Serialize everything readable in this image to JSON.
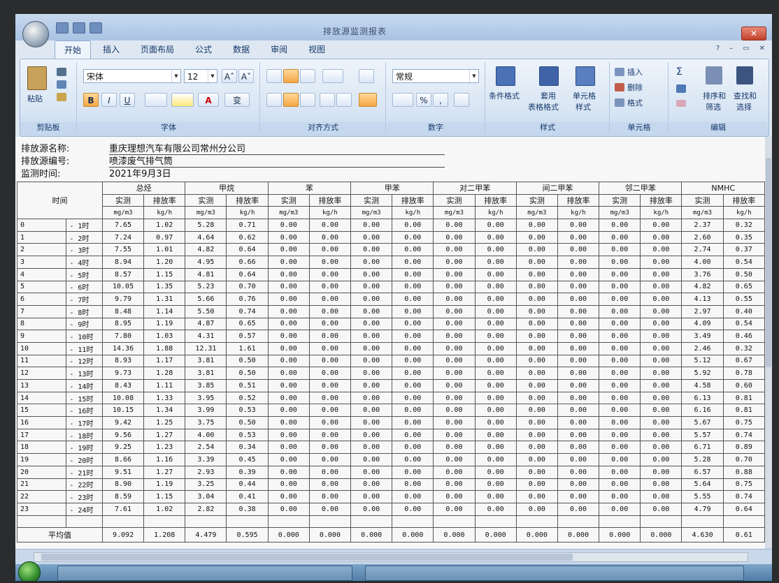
{
  "window": {
    "title": "排放源监测报表",
    "close_glyph": "✕",
    "controls": [
      "?",
      "–",
      "▭",
      "✕"
    ]
  },
  "tabs": [
    "开始",
    "插入",
    "页面布局",
    "公式",
    "数据",
    "审阅",
    "视图"
  ],
  "ribbon": {
    "clipboard": {
      "paste": "粘贴",
      "label": "剪贴板"
    },
    "font": {
      "name": "宋体",
      "size": "12",
      "grow": "A˄",
      "shrink": "A˅",
      "bold": "B",
      "italic": "I",
      "underline": "U",
      "color_glyph": "A",
      "wen": "变",
      "label": "字体"
    },
    "align": {
      "label": "对齐方式"
    },
    "number": {
      "format": "常规",
      "percent": "%",
      "comma": ",",
      "label": "数字"
    },
    "styles": {
      "cond": "条件格式",
      "table1": "套用",
      "table2": "表格格式",
      "cell1": "单元格",
      "cell2": "样式",
      "label": "样式"
    },
    "cells": {
      "insert": "插入",
      "delete": "删除",
      "format": "格式",
      "label": "单元格"
    },
    "editing": {
      "sort1": "排序和",
      "sort2": "筛选",
      "find1": "查找和",
      "find2": "选择",
      "label": "编辑"
    }
  },
  "sheet": {
    "meta": [
      {
        "label": "排放源名称:",
        "value": "重庆理想汽车有限公司常州分公司"
      },
      {
        "label": "排放源编号:",
        "value": "喷漆废气排气筒"
      },
      {
        "label": "监测时间:",
        "value": "2021年9月3日"
      }
    ],
    "time_header": "时间",
    "groups": [
      "总烃",
      "甲烷",
      "苯",
      "甲苯",
      "对二甲苯",
      "间二甲苯",
      "邻二甲苯",
      "NMHC"
    ],
    "sub_measured": "实测",
    "sub_rate": "排放率",
    "unit_measured": "mg/m3",
    "unit_rate": "kg/h",
    "zero": "0.00",
    "avg_label": "平均值",
    "rows": [
      {
        "h": "0",
        "r": "- 1时",
        "v": [
          "7.65",
          "1.02",
          "5.28",
          "0.71",
          "2.37",
          "0.32"
        ]
      },
      {
        "h": "1",
        "r": "- 2时",
        "v": [
          "7.24",
          "0.97",
          "4.64",
          "0.62",
          "2.60",
          "0.35"
        ]
      },
      {
        "h": "2",
        "r": "- 3时",
        "v": [
          "7.55",
          "1.01",
          "4.82",
          "0.64",
          "2.74",
          "0.37"
        ]
      },
      {
        "h": "3",
        "r": "- 4时",
        "v": [
          "8.94",
          "1.20",
          "4.95",
          "0.66",
          "4.00",
          "0.54"
        ]
      },
      {
        "h": "4",
        "r": "- 5时",
        "v": [
          "8.57",
          "1.15",
          "4.81",
          "0.64",
          "3.76",
          "0.50"
        ]
      },
      {
        "h": "5",
        "r": "- 6时",
        "v": [
          "10.05",
          "1.35",
          "5.23",
          "0.70",
          "4.82",
          "0.65"
        ]
      },
      {
        "h": "6",
        "r": "- 7时",
        "v": [
          "9.79",
          "1.31",
          "5.66",
          "0.76",
          "4.13",
          "0.55"
        ]
      },
      {
        "h": "7",
        "r": "- 8时",
        "v": [
          "8.48",
          "1.14",
          "5.50",
          "0.74",
          "2.97",
          "0.40"
        ]
      },
      {
        "h": "8",
        "r": "- 9时",
        "v": [
          "8.95",
          "1.19",
          "4.87",
          "0.65",
          "4.09",
          "0.54"
        ]
      },
      {
        "h": "9",
        "r": "- 10时",
        "v": [
          "7.80",
          "1.03",
          "4.31",
          "0.57",
          "3.49",
          "0.46"
        ]
      },
      {
        "h": "10",
        "r": "- 11时",
        "v": [
          "14.36",
          "1.88",
          "12.31",
          "1.61",
          "2.46",
          "0.32"
        ]
      },
      {
        "h": "11",
        "r": "- 12时",
        "v": [
          "8.93",
          "1.17",
          "3.81",
          "0.50",
          "5.12",
          "0.67"
        ]
      },
      {
        "h": "12",
        "r": "- 13时",
        "v": [
          "9.73",
          "1.28",
          "3.81",
          "0.50",
          "5.92",
          "0.78"
        ]
      },
      {
        "h": "13",
        "r": "- 14时",
        "v": [
          "8.43",
          "1.11",
          "3.85",
          "0.51",
          "4.58",
          "0.60"
        ]
      },
      {
        "h": "14",
        "r": "- 15时",
        "v": [
          "10.08",
          "1.33",
          "3.95",
          "0.52",
          "6.13",
          "0.81"
        ]
      },
      {
        "h": "15",
        "r": "- 16时",
        "v": [
          "10.15",
          "1.34",
          "3.99",
          "0.53",
          "6.16",
          "0.81"
        ]
      },
      {
        "h": "16",
        "r": "- 17时",
        "v": [
          "9.42",
          "1.25",
          "3.75",
          "0.50",
          "5.67",
          "0.75"
        ]
      },
      {
        "h": "17",
        "r": "- 18时",
        "v": [
          "9.56",
          "1.27",
          "4.00",
          "0.53",
          "5.57",
          "0.74"
        ]
      },
      {
        "h": "18",
        "r": "- 19时",
        "v": [
          "9.25",
          "1.23",
          "2.54",
          "0.34",
          "6.71",
          "0.89"
        ]
      },
      {
        "h": "19",
        "r": "- 20时",
        "v": [
          "8.66",
          "1.16",
          "3.39",
          "0.45",
          "5.28",
          "0.70"
        ]
      },
      {
        "h": "20",
        "r": "- 21时",
        "v": [
          "9.51",
          "1.27",
          "2.93",
          "0.39",
          "6.57",
          "0.88"
        ]
      },
      {
        "h": "21",
        "r": "- 22时",
        "v": [
          "8.90",
          "1.19",
          "3.25",
          "0.44",
          "5.64",
          "0.75"
        ]
      },
      {
        "h": "22",
        "r": "- 23时",
        "v": [
          "8.59",
          "1.15",
          "3.04",
          "0.41",
          "5.55",
          "0.74"
        ]
      },
      {
        "h": "23",
        "r": "- 24时",
        "v": [
          "7.61",
          "1.02",
          "2.82",
          "0.38",
          "4.79",
          "0.64"
        ]
      }
    ],
    "avg": [
      "9.092",
      "1.208",
      "4.479",
      "0.595",
      "0.000",
      "0.000",
      "0.000",
      "0.000",
      "0.000",
      "0.000",
      "0.000",
      "0.000",
      "0.000",
      "0.000",
      "4.630",
      "0.61"
    ]
  }
}
